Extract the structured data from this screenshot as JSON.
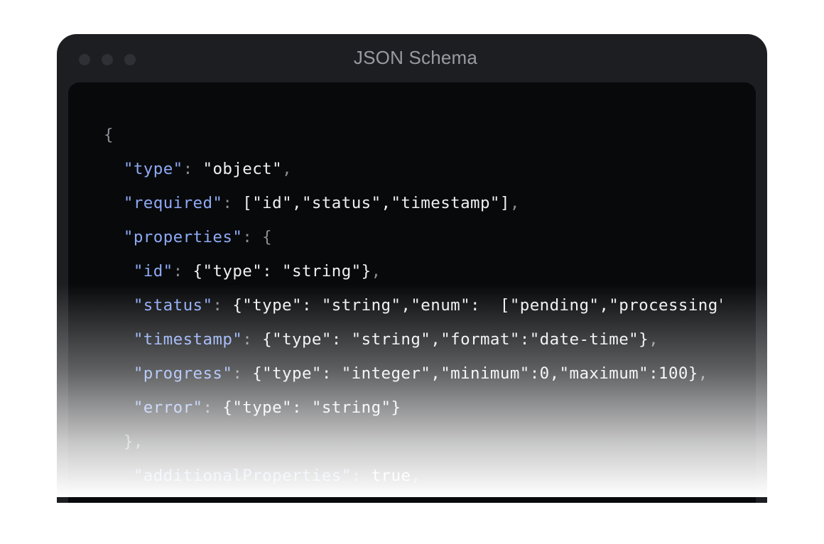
{
  "window": {
    "title": "JSON Schema",
    "traffic_lights": [
      "close-dot",
      "minimize-dot",
      "maximize-dot"
    ]
  },
  "code": {
    "lines": [
      {
        "indent": "",
        "tokens": [
          {
            "t": "p",
            "s": "{"
          }
        ]
      },
      {
        "indent": "  ",
        "tokens": [
          {
            "t": "k",
            "s": "\"type\""
          },
          {
            "t": "p",
            "s": ": "
          },
          {
            "t": "v",
            "s": "\"object\""
          },
          {
            "t": "p",
            "s": ","
          }
        ]
      },
      {
        "indent": "  ",
        "tokens": [
          {
            "t": "k",
            "s": "\"required\""
          },
          {
            "t": "p",
            "s": ": "
          },
          {
            "t": "v",
            "s": "[\"id\",\"status\",\"timestamp\"]"
          },
          {
            "t": "p",
            "s": ","
          }
        ]
      },
      {
        "indent": "  ",
        "tokens": [
          {
            "t": "k",
            "s": "\"properties\""
          },
          {
            "t": "p",
            "s": ": {"
          }
        ]
      },
      {
        "indent": "   ",
        "tokens": [
          {
            "t": "k",
            "s": "\"id\""
          },
          {
            "t": "p",
            "s": ": "
          },
          {
            "t": "v",
            "s": "{\"type\": \"string\"}"
          },
          {
            "t": "p",
            "s": ","
          }
        ]
      },
      {
        "indent": "   ",
        "tokens": [
          {
            "t": "k",
            "s": "\"status\""
          },
          {
            "t": "p",
            "s": ": "
          },
          {
            "t": "v",
            "s": "{\"type\": \"string\",\"enum\":  [\"pending\",\"processing\",\"completed\",\"failed\"]}"
          },
          {
            "t": "p",
            "s": ","
          }
        ]
      },
      {
        "indent": "   ",
        "tokens": [
          {
            "t": "k",
            "s": "\"timestamp\""
          },
          {
            "t": "p",
            "s": ": "
          },
          {
            "t": "v",
            "s": "{\"type\": \"string\",\"format\":\"date-time\"}"
          },
          {
            "t": "p",
            "s": ","
          }
        ]
      },
      {
        "indent": "   ",
        "tokens": [
          {
            "t": "k",
            "s": "\"progress\""
          },
          {
            "t": "p",
            "s": ": "
          },
          {
            "t": "v",
            "s": "{\"type\": \"integer\",\"minimum\":0,\"maximum\":100}"
          },
          {
            "t": "p",
            "s": ","
          }
        ]
      },
      {
        "indent": "   ",
        "tokens": [
          {
            "t": "k",
            "s": "\"error\""
          },
          {
            "t": "p",
            "s": ": "
          },
          {
            "t": "v",
            "s": "{\"type\": \"string\"}"
          }
        ]
      },
      {
        "indent": "  ",
        "tokens": [
          {
            "t": "p",
            "s": "},"
          }
        ]
      },
      {
        "indent": "   ",
        "tokens": [
          {
            "t": "k",
            "s": "\"additionalProperties\""
          },
          {
            "t": "p",
            "s": ": "
          },
          {
            "t": "v",
            "s": "true"
          },
          {
            "t": "p",
            "s": ","
          }
        ]
      }
    ]
  },
  "colors": {
    "key": "#8eaaf5",
    "value": "#eef0f2",
    "punctuation": "#8d8e94",
    "editor_bg": "#08090b",
    "window_bg": "#1d1e22"
  }
}
